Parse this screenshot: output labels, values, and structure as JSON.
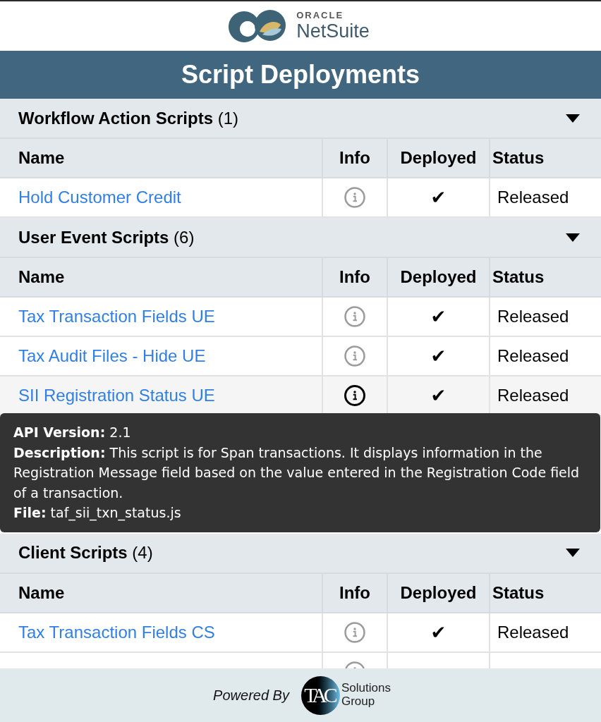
{
  "header": {
    "logo_small": "ORACLE",
    "logo_large": "NetSuite"
  },
  "title": "Script Deployments",
  "sections": [
    {
      "heading": "**Workflow Action Scripts** (1)",
      "expanded": true,
      "columns": [
        "Name",
        "Info",
        "Deployed",
        "Status"
      ],
      "rows": [
        {
          "name": "Hold Customer Credit",
          "hovered": false,
          "deployed": "✔",
          "status": "Released"
        }
      ]
    },
    {
      "heading": "**User Event Scripts** (6)",
      "expanded": true,
      "columns": [
        "Name",
        "Info",
        "Deployed",
        "Status"
      ],
      "rows": [
        {
          "name": "Tax Transaction Fields UE",
          "hovered": false,
          "deployed": "✔",
          "status": "Released"
        },
        {
          "name": "Tax Audit Files - Hide UE",
          "hovered": false,
          "deployed": "✔",
          "status": "Released"
        },
        {
          "name": "SII Registration Status UE",
          "hovered": true,
          "deployed": "✔",
          "status": "Released",
          "tooltip": [
            "**API Version:** 2.1",
            "**Description:** This script is for Span transactions. It displays information in the Registration Message field based on the value entered in the Registration Code field of a transaction.",
            "**File:** taf_sii_txn_status.js"
          ]
        }
      ]
    },
    {
      "heading": "**Client Scripts** (4)",
      "expanded": true,
      "columns": [
        "Name",
        "Info",
        "Deployed",
        "Status"
      ],
      "rows": [
        {
          "name": "Tax Transaction Fields CS",
          "hovered": false,
          "deployed": "✔",
          "status": "Released"
        },
        {
          "hovered": false
        }
      ]
    }
  ],
  "footer": {
    "powered_by": "Powered By",
    "logo_text": "TAC",
    "company_lines": [
      "Solutions",
      "Group"
    ]
  }
}
